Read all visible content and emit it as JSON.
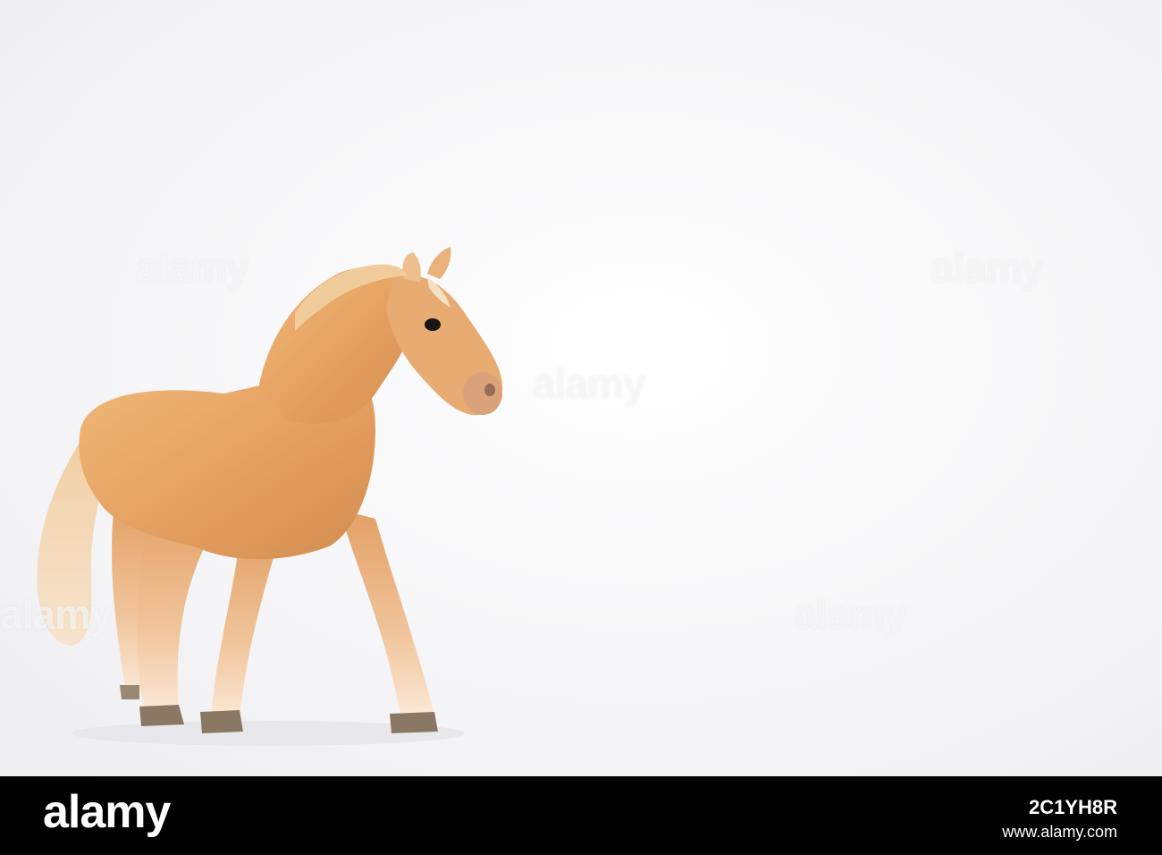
{
  "photo": {
    "subject_icon": "horse-figurine",
    "colors": {
      "coat": "#e8a868",
      "coat_shadow": "#c9834a",
      "mane": "#f2dcc0",
      "hoof": "#7a6a58",
      "background": "#f5f5f7"
    },
    "watermark_text": "alamy"
  },
  "footer": {
    "brand": "alamy",
    "image_code": "2C1YH8R",
    "site": "www.alamy.com"
  }
}
